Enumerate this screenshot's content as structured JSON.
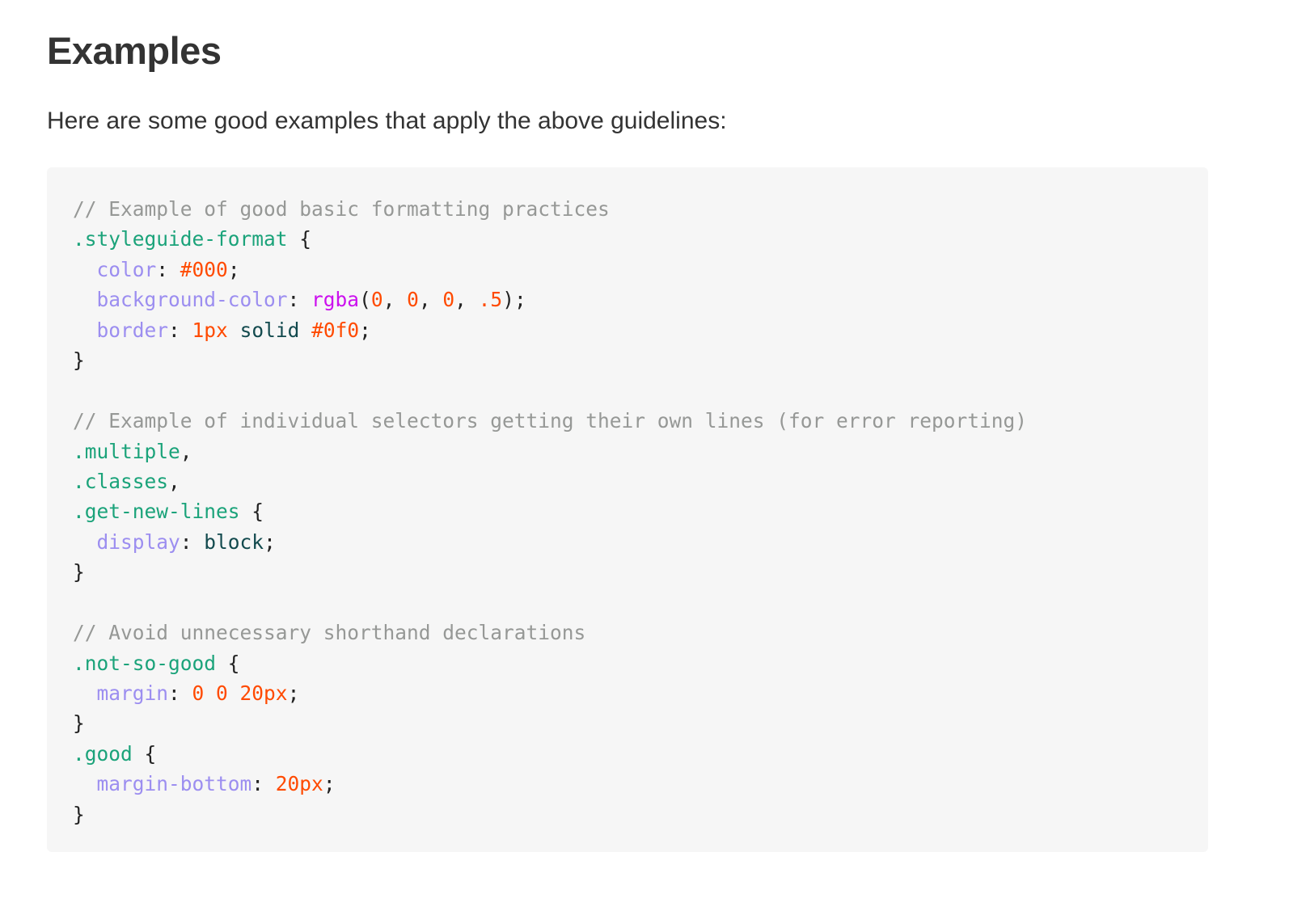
{
  "heading": "Examples",
  "intro": "Here are some good examples that apply the above guidelines:",
  "colors": {
    "comment": "#969896",
    "selector": "#1ba37a",
    "property": "#9c8ef0",
    "number": "#ff4a00",
    "function": "#cc11ee",
    "keyword": "#134a4e",
    "punctuation": "#222222",
    "code_background": "#f6f6f6"
  },
  "code": {
    "language": "scss",
    "lines": [
      [
        {
          "t": "comment",
          "v": "// Example of good basic formatting practices"
        }
      ],
      [
        {
          "t": "selector",
          "v": ".styleguide-format"
        },
        {
          "t": "punct",
          "v": " {"
        }
      ],
      [
        {
          "t": "punct",
          "v": "  "
        },
        {
          "t": "property",
          "v": "color"
        },
        {
          "t": "punct",
          "v": ": "
        },
        {
          "t": "number",
          "v": "#000"
        },
        {
          "t": "punct",
          "v": ";"
        }
      ],
      [
        {
          "t": "punct",
          "v": "  "
        },
        {
          "t": "property",
          "v": "background-color"
        },
        {
          "t": "punct",
          "v": ": "
        },
        {
          "t": "function",
          "v": "rgba"
        },
        {
          "t": "punct",
          "v": "("
        },
        {
          "t": "number",
          "v": "0"
        },
        {
          "t": "punct",
          "v": ", "
        },
        {
          "t": "number",
          "v": "0"
        },
        {
          "t": "punct",
          "v": ", "
        },
        {
          "t": "number",
          "v": "0"
        },
        {
          "t": "punct",
          "v": ", "
        },
        {
          "t": "number",
          "v": ".5"
        },
        {
          "t": "punct",
          "v": ");"
        }
      ],
      [
        {
          "t": "punct",
          "v": "  "
        },
        {
          "t": "property",
          "v": "border"
        },
        {
          "t": "punct",
          "v": ": "
        },
        {
          "t": "number",
          "v": "1px"
        },
        {
          "t": "keyword",
          "v": " solid "
        },
        {
          "t": "number",
          "v": "#0f0"
        },
        {
          "t": "punct",
          "v": ";"
        }
      ],
      [
        {
          "t": "punct",
          "v": "}"
        }
      ],
      [],
      [
        {
          "t": "comment",
          "v": "// Example of individual selectors getting their own lines (for error reporting)"
        }
      ],
      [
        {
          "t": "selector",
          "v": ".multiple"
        },
        {
          "t": "punct",
          "v": ","
        }
      ],
      [
        {
          "t": "selector",
          "v": ".classes"
        },
        {
          "t": "punct",
          "v": ","
        }
      ],
      [
        {
          "t": "selector",
          "v": ".get-new-lines"
        },
        {
          "t": "punct",
          "v": " {"
        }
      ],
      [
        {
          "t": "punct",
          "v": "  "
        },
        {
          "t": "property",
          "v": "display"
        },
        {
          "t": "punct",
          "v": ": "
        },
        {
          "t": "keyword",
          "v": "block"
        },
        {
          "t": "punct",
          "v": ";"
        }
      ],
      [
        {
          "t": "punct",
          "v": "}"
        }
      ],
      [],
      [
        {
          "t": "comment",
          "v": "// Avoid unnecessary shorthand declarations"
        }
      ],
      [
        {
          "t": "selector",
          "v": ".not-so-good"
        },
        {
          "t": "punct",
          "v": " {"
        }
      ],
      [
        {
          "t": "punct",
          "v": "  "
        },
        {
          "t": "property",
          "v": "margin"
        },
        {
          "t": "punct",
          "v": ": "
        },
        {
          "t": "number",
          "v": "0 0 20px"
        },
        {
          "t": "punct",
          "v": ";"
        }
      ],
      [
        {
          "t": "punct",
          "v": "}"
        }
      ],
      [
        {
          "t": "selector",
          "v": ".good"
        },
        {
          "t": "punct",
          "v": " {"
        }
      ],
      [
        {
          "t": "punct",
          "v": "  "
        },
        {
          "t": "property",
          "v": "margin-bottom"
        },
        {
          "t": "punct",
          "v": ": "
        },
        {
          "t": "number",
          "v": "20px"
        },
        {
          "t": "punct",
          "v": ";"
        }
      ],
      [
        {
          "t": "punct",
          "v": "}"
        }
      ]
    ]
  }
}
